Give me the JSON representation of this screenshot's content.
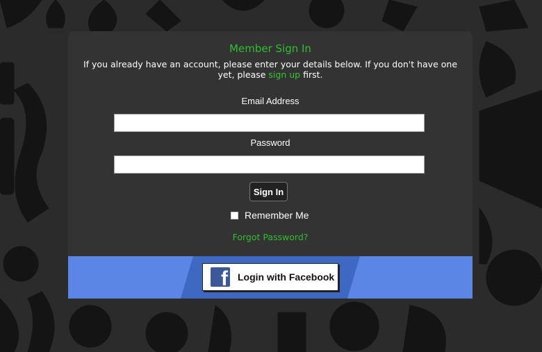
{
  "login": {
    "title": "Member Sign In",
    "intro_before": "If you already have an account, please enter your details below. If you don't have one yet, please ",
    "signup_link": "sign up",
    "intro_after": " first.",
    "email_label": "Email Address",
    "email_value": "",
    "password_label": "Password",
    "password_value": "",
    "signin_label": "Sign In",
    "remember_label": "Remember Me",
    "remember_checked": false,
    "forgot_label": "Forgot Password?"
  },
  "facebook": {
    "logo_glyph": "f",
    "button_label": "Login with Facebook"
  },
  "colors": {
    "accent_green": "#2fbf2f",
    "panel": "#333333",
    "facebook_band": "#5b86e5",
    "facebook_blue": "#3b5998"
  },
  "icons": {
    "facebook": "facebook-icon",
    "checkbox": "checkbox"
  }
}
